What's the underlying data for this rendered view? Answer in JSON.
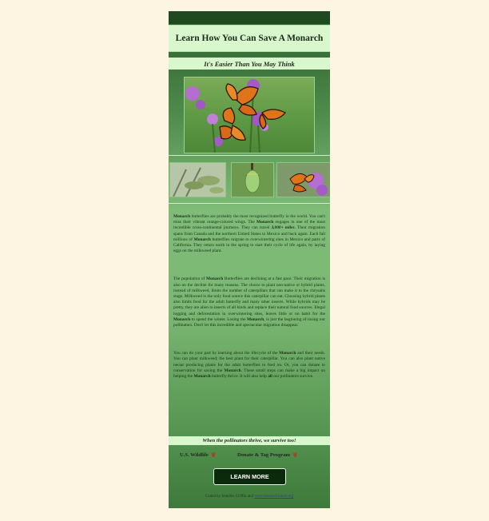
{
  "header": {
    "title": "Learn How You Can Save A Monarch",
    "subtitle": "It's Easier Than You May Think"
  },
  "images": {
    "hero": "monarch-butterflies-on-flowers",
    "thumbs": [
      "milkweed-plant",
      "chrysalis",
      "monarch-on-flower"
    ]
  },
  "body": {
    "p1": {
      "a": "Monarch",
      "b": " butterflies are probably the most recognized butterfly in the world. You can't miss their vibrant orange-colored wings. The ",
      "c": "Monarch",
      "d": " engages in one of the most incredible cross-continental journeys. They can travel ",
      "e": "3,000+ miles",
      "f": ". Their migration spans from Canada and the northern United States to Mexico and back again. Each fall millions of ",
      "g": "Monarch",
      "h": " butterflies migrate to overwintering sites in Mexico and parts of California. They return north in the spring to start their cycle of life again, by laying eggs on the milkweed plant."
    },
    "p2": {
      "a": "The population of ",
      "b": "Monarch",
      "c": " Butterflies are declining at a fast pace. Their migration is also on the decline for many reasons. The choice to plant non-native or hybrid plants, instead of milkweed, limits the number of caterpillars that can make it to the chrysalis stage. Milkweed is the only food source this caterpillar can eat. Choosing hybrid plants also limits food for the adult butterfly and many other insects. While hybrids may be pretty, they are alien to insects of all kinds and replace their natural food sources. Illegal logging and deforestation in overwintering sites, leaves little or no habit for the ",
      "d": "Monarch",
      "e": " to spend the winter. Losing the ",
      "f": "Monarch",
      "g": ", is just the beginning of losing our pollinators. Don't let this incredible and spectacular migration disappear."
    },
    "p3": {
      "a": "You can do your part by learning about the lifecycle of the ",
      "b": "Monarch",
      "c": " and their needs. You can plant milkweed; the best plant for their caterpillar. You can also plant native nectar producing plants for the adult butterflies to feed on. Or, you can donate to conservation for saving the ",
      "d": "Monarch",
      "e": ". These small steps can make a big impact on helping the ",
      "f": "Monarch",
      "g": " butterfly thrive. It will also help ",
      "h": "all",
      "i": " our pollinators survive."
    }
  },
  "tagline": "When the pollinators thrive, we survive too!",
  "links": {
    "wildlife": "U.S. Wildlife",
    "donate": "Donate & Tag Program",
    "icon": "butterfly-icon"
  },
  "cta": {
    "label": "LEARN MORE"
  },
  "footer": {
    "credit_prefix": "Coded by Jennifer Griffin and ",
    "credit_link": "www.monarchwatch.org"
  },
  "colors": {
    "page_bg": "#fdf5e2",
    "panel_light": "#d9f7cc",
    "button_bg": "#0b2a0c",
    "monarch_orange": "#e07a1f"
  }
}
